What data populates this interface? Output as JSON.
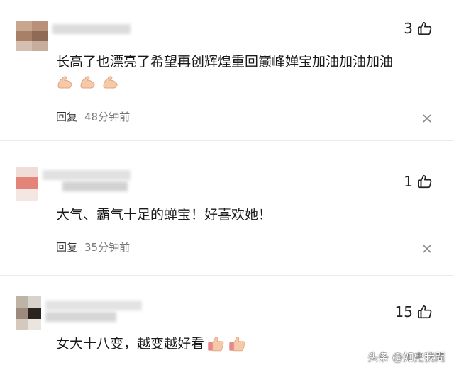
{
  "comments": [
    {
      "likes": "3",
      "text": "长高了也漂亮了希望再创辉煌重回巅峰婵宝加油加油加油",
      "emoji_icons": [
        "flexed-biceps-icon",
        "flexed-biceps-icon",
        "flexed-biceps-icon"
      ],
      "reply_label": "回复",
      "time": "48分钟前"
    },
    {
      "likes": "1",
      "text": "大气、霸气十足的蝉宝！好喜欢她！",
      "reply_label": "回复",
      "time": "35分钟前"
    },
    {
      "likes": "15",
      "text": "女大十八变，越变越好看",
      "emoji_icons": [
        "thumbs-up-icon",
        "thumbs-up-icon"
      ]
    }
  ],
  "watermark": "头条 @如史我聞",
  "colors": {
    "blur_gray": "#d9d9d9",
    "skin": "#f6c9a8",
    "thumb_pink": "#e8888e"
  }
}
